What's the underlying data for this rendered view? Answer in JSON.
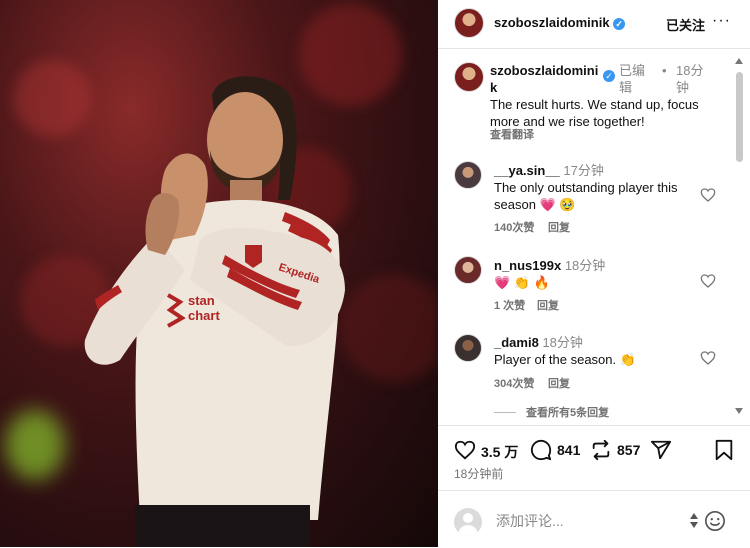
{
  "post_image": {
    "alt": ""
  },
  "header": {
    "username": "szoboszlaidominik",
    "follow_label": "已关注",
    "more_label": "···"
  },
  "caption": {
    "username_line1": "szoboszlaidomini",
    "username_line2": "k",
    "edited": "已编",
    "edited2": "辑",
    "dot": "•",
    "time_line1": "18分",
    "time_line2": "钟",
    "text_line1": "The result hurts. We stand up, focus",
    "text_line2": "more and we rise together!",
    "translate": "查看翻译"
  },
  "comments": [
    {
      "user": "__ya.sin__",
      "time": "17分钟",
      "line1": "The only outstanding player this",
      "line2": "season ",
      "emoji": "💗 🥹",
      "likes": "140次赞",
      "reply": "回复"
    },
    {
      "user": "n_nus199x",
      "time": "18分钟",
      "line1": "",
      "emoji": "💗 👏 🔥",
      "likes": "1 次赞",
      "reply": "回复"
    },
    {
      "user": "_dami8",
      "time": "18分钟",
      "line1": "Player of the season. ",
      "emoji": "👏",
      "likes": "304次赞",
      "reply": "回复"
    }
  ],
  "view_replies": "查看所有5条回复",
  "actions": {
    "likes": "3.5 万",
    "comments": "841",
    "shares": "857",
    "time_ago": "18分钟前"
  },
  "comment_box": {
    "placeholder": "添加评论..."
  }
}
